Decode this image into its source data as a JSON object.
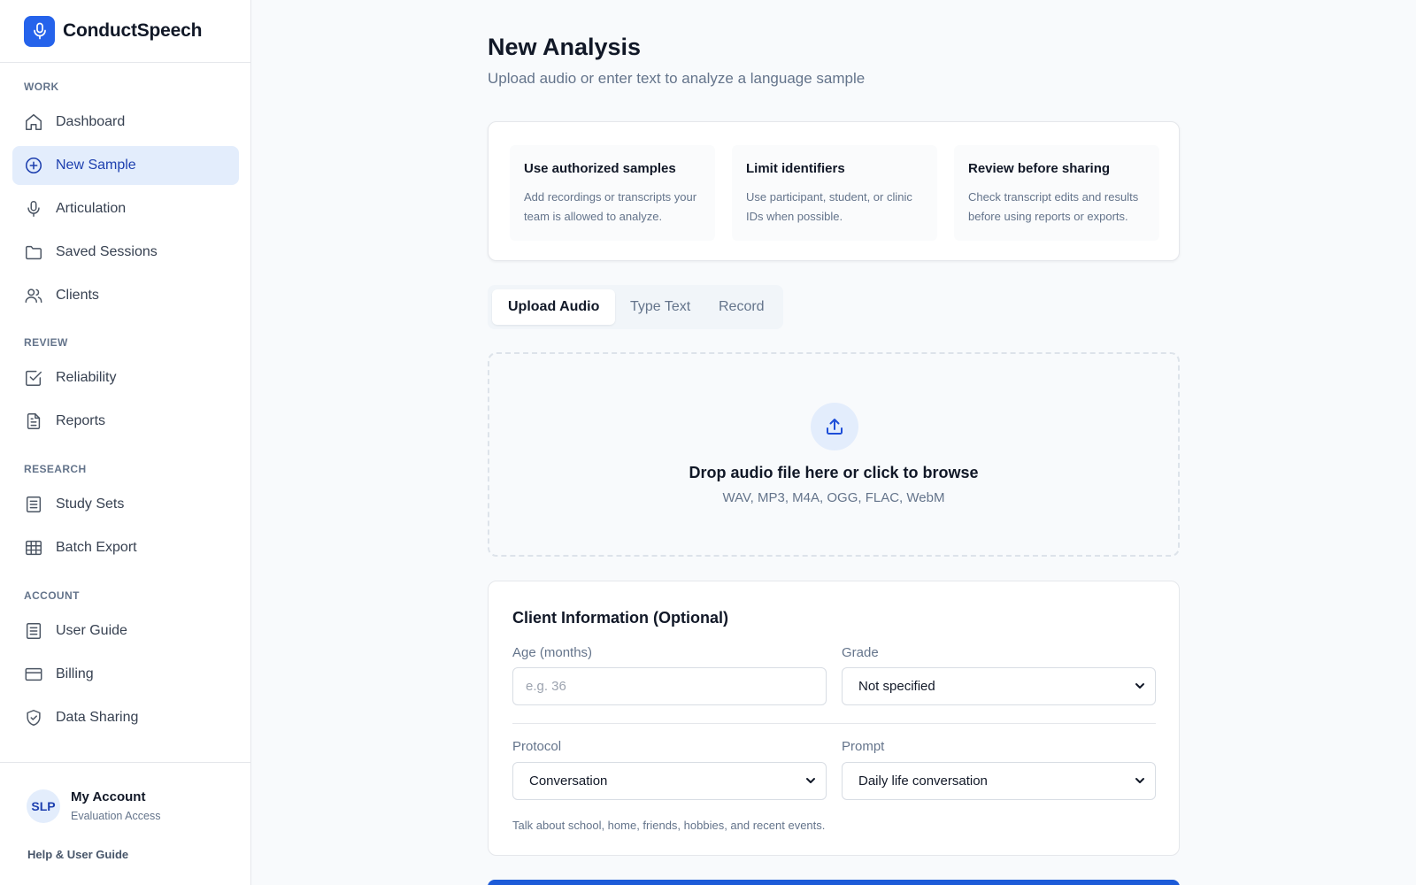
{
  "app": {
    "name": "ConductSpeech",
    "accent": "#2563eb"
  },
  "sidebar": {
    "sections": {
      "work": "WORK",
      "review": "REVIEW",
      "research": "RESEARCH",
      "account": "ACCOUNT"
    },
    "items": {
      "dashboard": "Dashboard",
      "new_sample": "New Sample",
      "articulation": "Articulation",
      "saved_sessions": "Saved Sessions",
      "clients": "Clients",
      "reliability": "Reliability",
      "reports": "Reports",
      "study_sets": "Study Sets",
      "batch_export": "Batch Export",
      "user_guide": "User Guide",
      "billing": "Billing",
      "data_sharing": "Data Sharing"
    },
    "active_item": "New Sample",
    "account": {
      "initials": "SLP",
      "name": "My Account",
      "subtitle": "Evaluation Access",
      "help_link": "Help & User Guide"
    }
  },
  "main": {
    "title": "New Analysis",
    "subtitle": "Upload audio or enter text to analyze a language sample",
    "notices": [
      {
        "title": "Use authorized samples",
        "body": "Add recordings or transcripts your team is allowed to analyze."
      },
      {
        "title": "Limit identifiers",
        "body": "Use participant, student, or clinic IDs when possible."
      },
      {
        "title": "Review before sharing",
        "body": "Check transcript edits and results before using reports or exports."
      }
    ],
    "tabs": [
      "Upload Audio",
      "Type Text",
      "Record"
    ],
    "active_tab": "Upload Audio",
    "dropzone": {
      "title": "Drop audio file here or click to browse",
      "formats": "WAV, MP3, M4A, OGG, FLAC, WebM"
    },
    "client_info": {
      "title": "Client Information (Optional)",
      "age_label": "Age (months)",
      "age_placeholder": "e.g. 36",
      "age_value": "",
      "grade_label": "Grade",
      "grade_value": "Not specified",
      "protocol_label": "Protocol",
      "protocol_value": "Conversation",
      "prompt_label": "Prompt",
      "prompt_value": "Daily life conversation",
      "hint": "Talk about school, home, friends, hobbies, and recent events."
    }
  }
}
